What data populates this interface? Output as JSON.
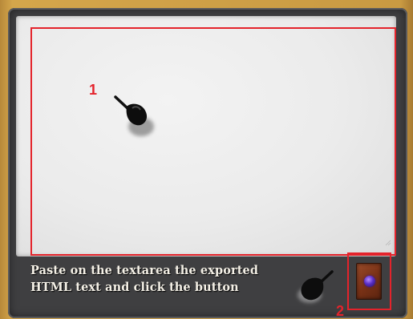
{
  "annotations": {
    "marker_1": "1",
    "marker_2": "2"
  },
  "import_panel": {
    "textarea_value": "",
    "instruction_line_1": "Paste on the textarea the exported",
    "instruction_line_2": "HTML text and click the button",
    "button_icon": "spellbook-icon"
  },
  "colors": {
    "highlight": "#e4232b",
    "panel": "#3f3f41",
    "background": "#c99a42",
    "text": "#f4f0e6"
  }
}
